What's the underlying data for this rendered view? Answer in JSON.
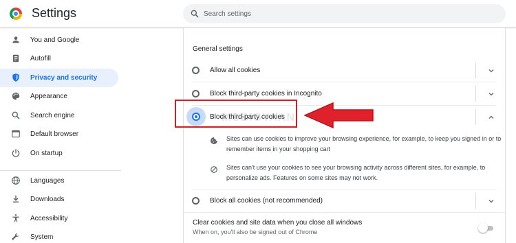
{
  "header": {
    "title": "Settings",
    "search_placeholder": "Search settings"
  },
  "sidebar": {
    "items": [
      {
        "label": "You and Google",
        "icon": "person-icon"
      },
      {
        "label": "Autofill",
        "icon": "autofill-icon"
      },
      {
        "label": "Privacy and security",
        "icon": "shield-icon",
        "active": true
      },
      {
        "label": "Appearance",
        "icon": "palette-icon"
      },
      {
        "label": "Search engine",
        "icon": "search-icon"
      },
      {
        "label": "Default browser",
        "icon": "browser-icon"
      },
      {
        "label": "On startup",
        "icon": "power-icon"
      },
      {
        "label": "Languages",
        "icon": "globe-icon"
      },
      {
        "label": "Downloads",
        "icon": "download-icon"
      },
      {
        "label": "Accessibility",
        "icon": "accessibility-icon"
      },
      {
        "label": "System",
        "icon": "wrench-icon"
      }
    ]
  },
  "main": {
    "section_title": "General settings",
    "options": [
      {
        "label": "Allow all cookies",
        "selected": false
      },
      {
        "label": "Block third-party cookies in Incognito",
        "selected": false
      },
      {
        "label": "Block third-party cookies",
        "selected": true
      },
      {
        "label": "Block all cookies (not recommended)",
        "selected": false
      }
    ],
    "details": [
      {
        "icon": "cookie-icon",
        "text": "Sites can use cookies to improve your browsing experience, for example, to keep you signed in or to remember items in your shopping cart"
      },
      {
        "icon": "block-icon",
        "text": "Sites can't use your cookies to see your browsing activity across different sites, for example, to personalize ads. Features on some sites may not work."
      }
    ],
    "toggle": {
      "title": "Clear cookies and site data when you close all windows",
      "subtitle": "When on, you'll also be signed out of Chrome",
      "on": false
    }
  },
  "watermark": "MOBIGYAAN",
  "colors": {
    "accent": "#1a73e8",
    "active_bg": "#e8f0fe",
    "annotation_red": "#d01f26"
  }
}
